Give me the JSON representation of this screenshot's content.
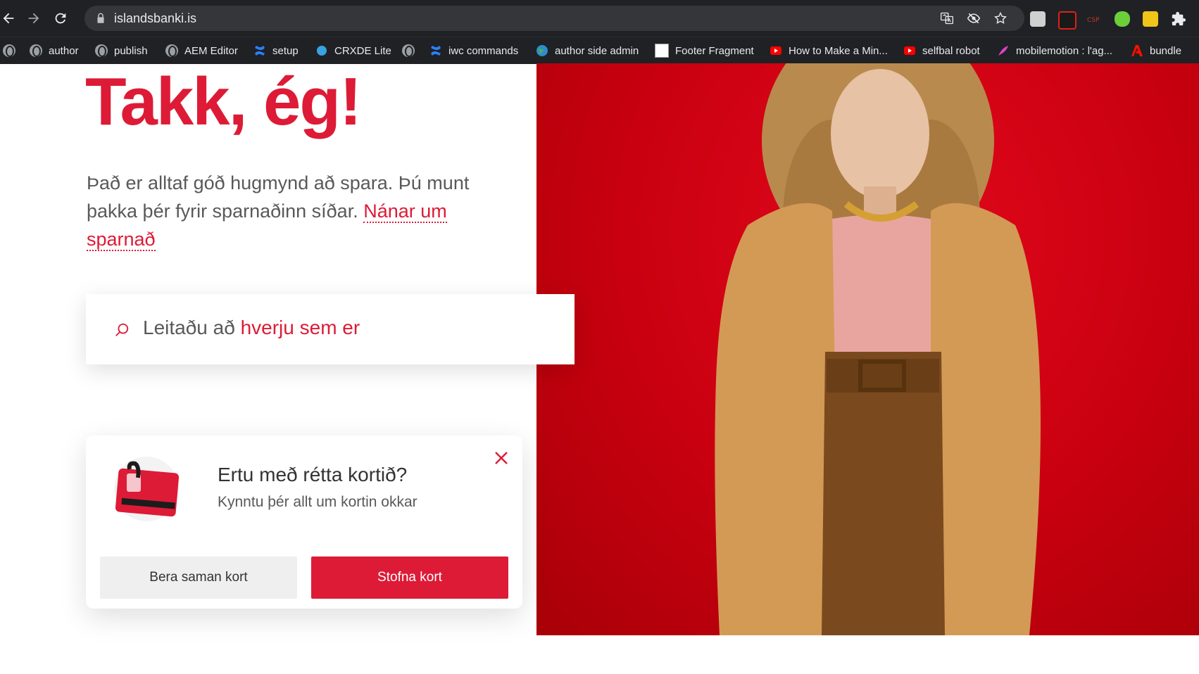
{
  "browser": {
    "url": "islandsbanki.is",
    "bookmarks": [
      {
        "label": ""
      },
      {
        "label": "author"
      },
      {
        "label": "publish"
      },
      {
        "label": "AEM Editor"
      },
      {
        "label": "setup"
      },
      {
        "label": "CRXDE Lite"
      },
      {
        "label": ""
      },
      {
        "label": "iwc commands"
      },
      {
        "label": "author side admin"
      },
      {
        "label": "Footer Fragment"
      },
      {
        "label": "How to Make a Min..."
      },
      {
        "label": "selfbal robot"
      },
      {
        "label": "mobilemotion : l'ag..."
      },
      {
        "label": "bundle"
      }
    ]
  },
  "hero": {
    "headline": "Takk, ég!",
    "lead_text": "Það er alltaf góð hugmynd að spara. Þú munt þakka þér fyrir sparnaðinn síðar.",
    "lead_link": "Nánar um sparnað"
  },
  "search": {
    "prefix": "Leitaðu að",
    "highlight": "hverju sem er"
  },
  "card_promo": {
    "title": "Ertu með rétta kortið?",
    "subtitle": "Kynntu þér allt um kortin okkar",
    "secondary_button": "Bera saman kort",
    "primary_button": "Stofna kort"
  },
  "colors": {
    "brand_red": "#dd1b36",
    "chrome_bg": "#202124"
  }
}
